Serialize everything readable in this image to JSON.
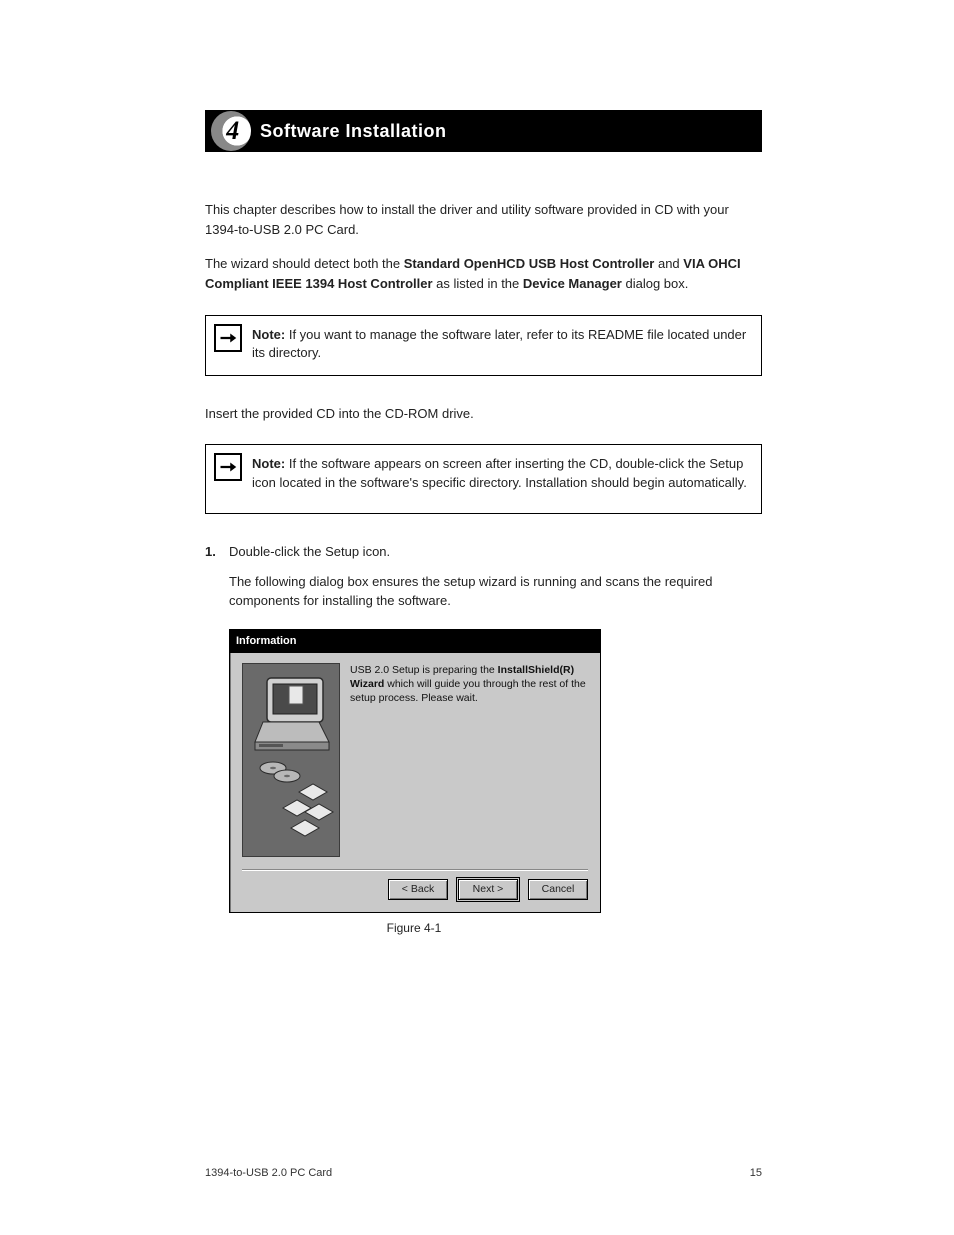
{
  "chapter": {
    "number": "4",
    "title": "Software Installation"
  },
  "intro": {
    "p1": "This chapter describes how to install the driver and utility software provided in CD with your 1394-to-USB 2.0 PC Card.",
    "p2a": "The wizard should detect both the ",
    "p2b": "Standard OpenHCD USB Host Controller",
    "p2c": " and ",
    "p2d": "VIA OHCI Compliant IEEE 1394 Host Controller",
    "p2e": " as listed in the ",
    "p2f": "Device Manager",
    "p2g": " dialog box.",
    "p3": "Insert the provided CD into the CD-ROM drive."
  },
  "note1": {
    "label": "Note:",
    "text": " If you want to manage the software later, refer to its README file located under its directory."
  },
  "note2": {
    "label": "Note:",
    "text": " If the software appears on screen after inserting the CD, double-click the Setup icon located in the software's specific directory. Installation should begin automatically."
  },
  "step1": {
    "num": "1.",
    "text": "Double-click the Setup icon."
  },
  "step1_desc": "The following dialog box ensures the setup wizard is running and scans the required components for installing the software.",
  "dialog": {
    "title": "Information",
    "right": {
      "line1a": "USB 2.0 Setup is preparing the ",
      "line1b": "InstallShield(R) Wizard",
      "line1c": " which will guide you through the rest of the setup process. Please wait."
    },
    "buttons": {
      "back": "< Back",
      "next": "Next >",
      "cancel": "Cancel"
    }
  },
  "caption": "Figure 4-1",
  "footer": {
    "left": "1394-to-USB 2.0 PC Card",
    "right": "15"
  }
}
